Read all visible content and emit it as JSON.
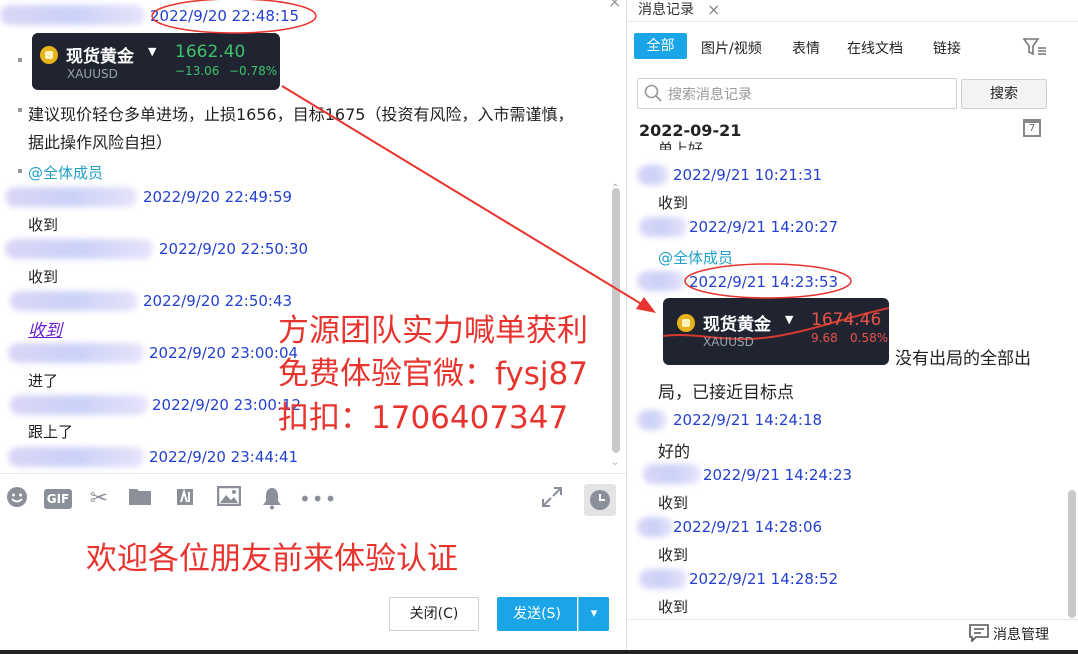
{
  "chat": {
    "m1": {
      "time": "2022/9/20 22:48:15"
    },
    "card1": {
      "name": "现货黄金",
      "symbol": "XAUUSD",
      "price": "1662.40",
      "change": "−13.06",
      "pct": "−0.78%"
    },
    "m2": {
      "text1": "建议现价轻仓多单进场，止损1656，目标1675（投资有风险，入市需谨慎，",
      "text2": "据此操作风险自担）",
      "mention": "@全体成员"
    },
    "m3": {
      "time": "2022/9/20 22:49:59",
      "text": "收到"
    },
    "m4": {
      "time": "2022/9/20 22:50:30",
      "text": "收到"
    },
    "m5": {
      "time": "2022/9/20 22:50:43",
      "text": "收到"
    },
    "m6": {
      "time": "2022/9/20 23:00:04",
      "text": "进了"
    },
    "m7": {
      "time": "2022/9/20 23:00:12",
      "text": "跟上了"
    },
    "m8": {
      "time": "2022/9/20 23:44:41"
    }
  },
  "overlay": {
    "line1": "方源团队实力喊单获利",
    "line2": "免费体验官微：fysj87",
    "line3": "扣扣：1706407347",
    "welcome": "欢迎各位朋友前来体验认证"
  },
  "buttons": {
    "close": "关闭(C)",
    "send": "发送(S)",
    "dropdown": "▾"
  },
  "toolbar_icons": [
    "emoji-icon",
    "gif-icon",
    "scissors-icon",
    "folder-icon",
    "quick-reply-icon",
    "image-icon",
    "bell-icon",
    "more-icon"
  ],
  "history": {
    "tab_title": "消息记录",
    "close": "×",
    "tabs": [
      "全部",
      "图片/视频",
      "表情",
      "在线文档",
      "链接"
    ],
    "active_tab": "全部",
    "search_placeholder": "搜索消息记录",
    "search_button": "搜索",
    "date": "2022-09-21",
    "calendar_day": "7",
    "partial_text": "单上好",
    "h1": {
      "time": "2022/9/21 10:21:31",
      "text": "收到"
    },
    "h2": {
      "time": "2022/9/21 14:20:27",
      "mention": "@全体成员"
    },
    "h3": {
      "time": "2022/9/21 14:23:53"
    },
    "card2": {
      "name": "现货黄金",
      "symbol": "XAUUSD",
      "price": "1674.46",
      "change": "9.68",
      "pct": "0.58%"
    },
    "h3_text1": "没有出局的全部出",
    "h3_text2": "局，已接近目标点",
    "h4": {
      "time": "2022/9/21 14:24:18",
      "text": "好的"
    },
    "h5": {
      "time": "2022/9/21 14:24:23",
      "text": "收到"
    },
    "h6": {
      "time": "2022/9/21 14:28:06",
      "text": "收到"
    },
    "h7": {
      "time": "2022/9/21 14:28:52",
      "text": "收到"
    },
    "manage": "消息管理"
  },
  "colors": {
    "accent": "#1aa5e8",
    "annotation": "#e8342f",
    "timestamp": "#2440d0",
    "up": "#e8534a",
    "down": "#3dc46b"
  }
}
